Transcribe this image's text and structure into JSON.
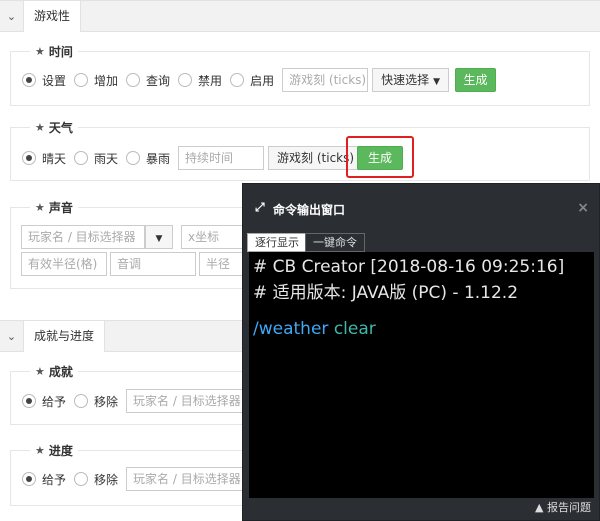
{
  "sections": {
    "gamerule_tab": "游戏性",
    "advancement_tab": "成就与进度"
  },
  "time": {
    "legend": "时间",
    "options": [
      "设置",
      "增加",
      "查询",
      "禁用",
      "启用"
    ],
    "selected_index": 0,
    "input_placeholder": "游戏刻 (ticks)",
    "quick_select_label": "快速选择",
    "generate_label": "生成"
  },
  "weather": {
    "legend": "天气",
    "options": [
      "晴天",
      "雨天",
      "暴雨"
    ],
    "selected_index": 0,
    "duration_placeholder": "持续时间",
    "unit_label": "游戏刻 (ticks)",
    "generate_label": "生成"
  },
  "sound": {
    "legend": "声音",
    "player_placeholder": "玩家名 / 目标选择器",
    "x_placeholder": "x坐标",
    "radius_placeholder": "有效半径(格)",
    "pitch_placeholder": "音调",
    "min_volume_placeholder": "半径外音"
  },
  "achievement": {
    "legend": "成就",
    "options": [
      "给予",
      "移除"
    ],
    "selected_index": 0,
    "player_placeholder": "玩家名 / 目标选择器"
  },
  "progress": {
    "legend": "进度",
    "options": [
      "给予",
      "移除"
    ],
    "selected_index": 0,
    "player_placeholder": "玩家名 / 目标选择器"
  },
  "command_window": {
    "title": "命令输出窗口",
    "close_glyph": "×",
    "tabs": [
      "逐行显示",
      "一键命令"
    ],
    "active_tab": 0,
    "lines": {
      "header": "# CB Creator [2018-08-16 09:25:16]",
      "version": "# 适用版本: JAVA版 (PC) - 1.12.2",
      "command": "/weather",
      "argument": "clear"
    },
    "report_label": "报告问题"
  },
  "colors": {
    "generate_green": "#5cb85c",
    "highlight_red": "#e02020",
    "command_blue": "#3fa9f5",
    "argument_teal": "#3fb8a8"
  }
}
